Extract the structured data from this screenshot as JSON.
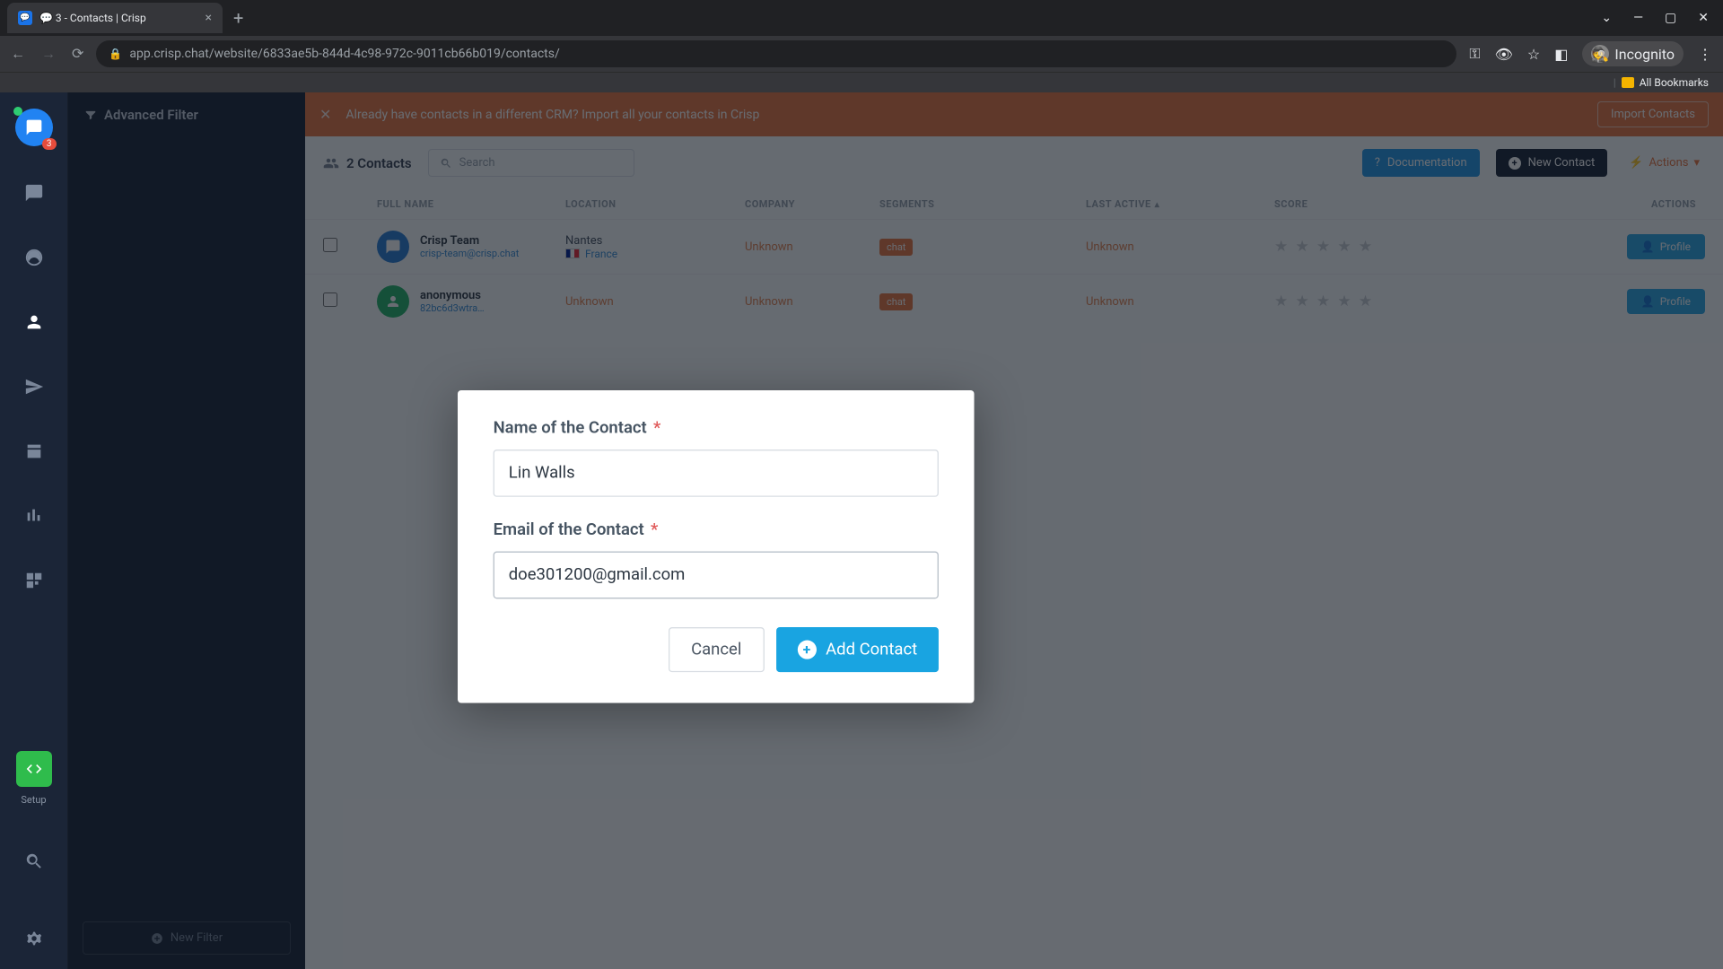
{
  "browser": {
    "tab_title": "💬 3 - Contacts | Crisp",
    "url": "app.crisp.chat/website/6833ae5b-844d-4c98-972c-9011cb66b019/contacts/",
    "incognito_label": "Incognito",
    "all_bookmarks": "All Bookmarks"
  },
  "rail": {
    "badge": "3",
    "setup_label": "Setup"
  },
  "filter": {
    "title": "Advanced Filter",
    "new_filter": "New Filter"
  },
  "banner": {
    "text": "Already have contacts in a different CRM? Import all your contacts in Crisp",
    "import": "Import Contacts"
  },
  "toolbar": {
    "count_label": "2 Contacts",
    "search_placeholder": "Search",
    "documentation": "Documentation",
    "new_contact": "New Contact",
    "actions": "Actions"
  },
  "table": {
    "headers": {
      "full_name": "FULL NAME",
      "location": "LOCATION",
      "company": "COMPANY",
      "segments": "SEGMENTS",
      "last_active": "LAST ACTIVE",
      "score": "SCORE",
      "actions": "ACTIONS"
    },
    "rows": [
      {
        "name": "Crisp Team",
        "email": "crisp-team@crisp.chat",
        "city": "Nantes",
        "country": "France",
        "company": "Unknown",
        "segment": "chat",
        "last_active": "Unknown",
        "profile": "Profile",
        "avatar_color": "#2a7fd4"
      },
      {
        "name": "anonymous",
        "email": "82bc6d3wtra…",
        "city": "Unknown",
        "country": "",
        "company": "Unknown",
        "segment": "chat",
        "last_active": "Unknown",
        "profile": "Profile",
        "avatar_color": "#26b56a"
      }
    ]
  },
  "modal": {
    "name_label": "Name of the Contact",
    "email_label": "Email of the Contact",
    "name_value": "Lin Walls",
    "email_value": "doe301200@gmail.com",
    "cancel": "Cancel",
    "add": "Add Contact"
  }
}
